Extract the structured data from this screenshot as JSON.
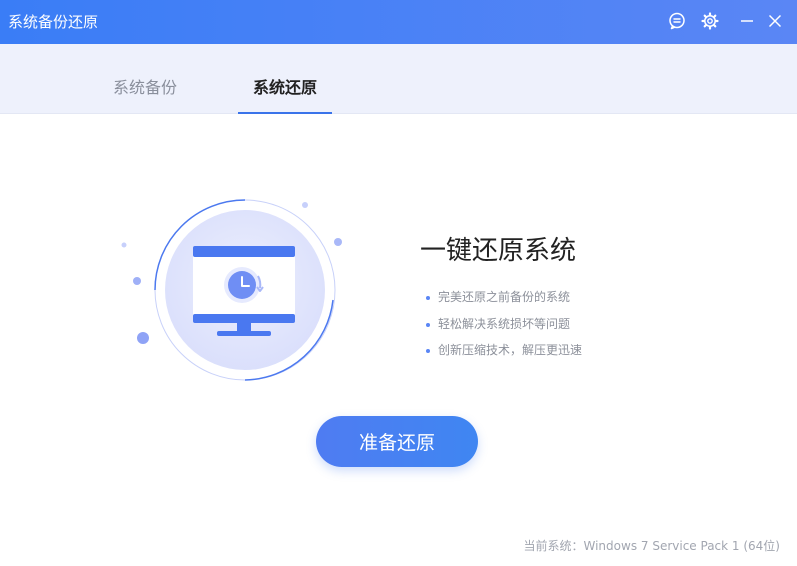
{
  "window": {
    "title": "系统备份还原",
    "controls": {
      "feedback_icon": "chat-bubble-icon",
      "settings_icon": "gear-icon",
      "minimize_icon": "minimize-icon",
      "close_icon": "close-icon"
    }
  },
  "tabs": [
    {
      "label": "系统备份",
      "active": false
    },
    {
      "label": "系统还原",
      "active": true
    }
  ],
  "main": {
    "headline": "一键还原系统",
    "features": [
      "完美还原之前备份的系统",
      "轻松解决系统损坏等问题",
      "创新压缩技术，解压更迅速"
    ],
    "action_button": "准备还原",
    "illustration_icon": "monitor-restore-clock-icon"
  },
  "footer": {
    "status_text": "当前系统：Windows 7 Service Pack 1 (64位)"
  },
  "colors": {
    "accent": "#3a7df6",
    "tab_underline": "#3a73ea",
    "tabbar_bg": "#eef1fc"
  }
}
